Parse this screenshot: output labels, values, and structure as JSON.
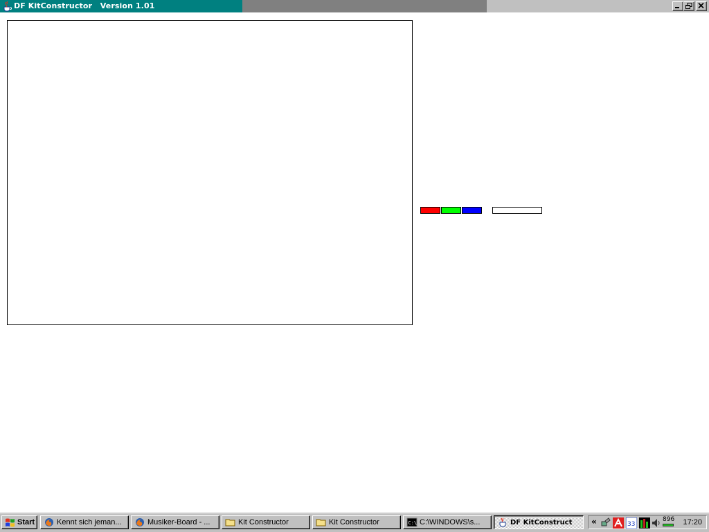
{
  "window": {
    "title": "DF KitConstructor   Version 1.01",
    "controls": {
      "minimize": "minimize",
      "restore": "restore",
      "close": "close"
    }
  },
  "colors": {
    "titlebar_active": "#008080",
    "titlebar_inactive": "#808080",
    "swatch_red": "#ff0000",
    "swatch_green": "#00ff00",
    "swatch_blue": "#0000ff"
  },
  "taskbar": {
    "start_label": "Start",
    "items": [
      {
        "label": "Kennt sich jeman...",
        "icon": "firefox-icon"
      },
      {
        "label": "Musiker-Board - ...",
        "icon": "firefox-icon"
      },
      {
        "label": "Kit Constructor",
        "icon": "folder-icon"
      },
      {
        "label": "Kit Constructor",
        "icon": "folder-icon"
      },
      {
        "label": "C:\\WINDOWS\\s...",
        "icon": "console-icon"
      },
      {
        "label": "DF KitConstruct",
        "icon": "java-icon",
        "active": true
      }
    ],
    "tray": {
      "expand": "«",
      "badge": "896",
      "clock": "17:20"
    }
  }
}
